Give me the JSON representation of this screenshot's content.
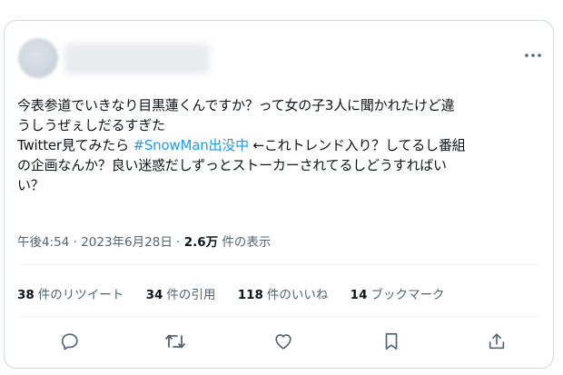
{
  "tweet": {
    "lines": [
      {
        "text": "今表参道でいきなり目黒蓮くんですか？って女の子3人に聞かれたけど違"
      },
      {
        "text": "うしうぜぇしだるすぎた"
      },
      {
        "pre": "Twitter見てみたら ",
        "hashtag": "#SnowMan出没中",
        "post": " ←これトレンド入り？してるし番組"
      },
      {
        "text": "の企画なんか？良い迷惑だしずっとストーカーされてるしどうすればい"
      },
      {
        "text": "い？"
      }
    ]
  },
  "meta": {
    "time": "午後4:54",
    "dot1": " · ",
    "date": "2023年6月28日",
    "dot2": " · ",
    "views_count": "2.6万",
    "views_label": " 件の表示"
  },
  "stats": [
    {
      "count": "38",
      "label": "件のリツイート"
    },
    {
      "count": "34",
      "label": "件の引用"
    },
    {
      "count": "118",
      "label": "件のいいね"
    },
    {
      "count": "14",
      "label": "ブックマーク"
    }
  ],
  "icons": {
    "more": "more-icon",
    "reply": "reply-icon",
    "retweet": "retweet-icon",
    "like": "heart-icon",
    "bookmark": "bookmark-icon",
    "share": "share-icon"
  },
  "colors": {
    "hashtag": "#1d9bf0",
    "text": "#0f1419",
    "secondary": "#536471",
    "border": "#cfd9de"
  }
}
